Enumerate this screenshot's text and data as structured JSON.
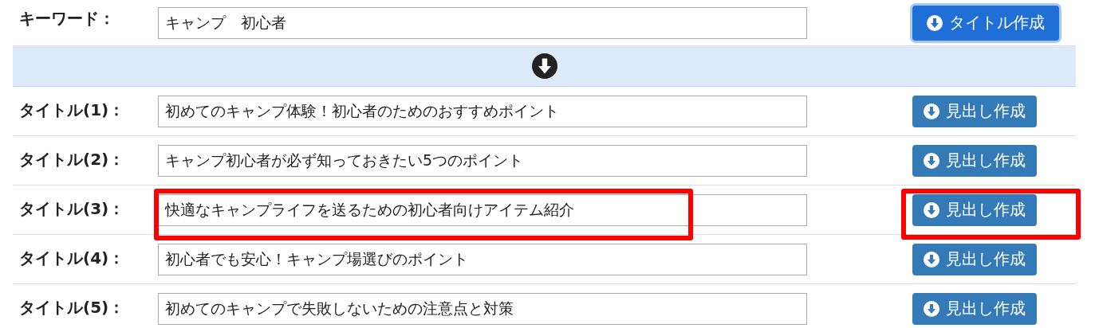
{
  "keyword": {
    "label": "キーワード：",
    "value": "キャンプ　初心者",
    "button": "タイトル作成",
    "focused": true
  },
  "titles": [
    {
      "label": "タイトル(1)：",
      "value": "初めてのキャンプ体験！初心者のためのおすすめポイント",
      "button": "見出し作成",
      "highlighted": false
    },
    {
      "label": "タイトル(2)：",
      "value": "キャンプ初心者が必ず知っておきたい5つのポイント",
      "button": "見出し作成",
      "highlighted": false
    },
    {
      "label": "タイトル(3)：",
      "value": "快適なキャンプライフを送るための初心者向けアイテム紹介",
      "button": "見出し作成",
      "highlighted": true
    },
    {
      "label": "タイトル(4)：",
      "value": "初心者でも安心！キャンプ場選びのポイント",
      "button": "見出し作成",
      "highlighted": false
    },
    {
      "label": "タイトル(5)：",
      "value": "初めてのキャンプで失敗しないための注意点と対策",
      "button": "見出し作成",
      "highlighted": false
    }
  ]
}
